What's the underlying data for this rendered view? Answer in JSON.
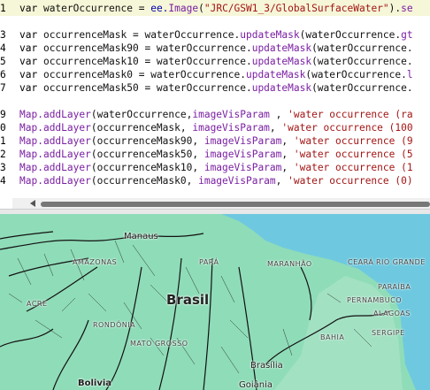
{
  "editor": {
    "lines": [
      {
        "num": "1",
        "parts": [
          [
            "kw",
            "var "
          ],
          [
            "code",
            "waterOccurrence = "
          ],
          [
            "obj",
            "ee."
          ],
          [
            "m",
            "Image"
          ],
          [
            "code",
            "("
          ],
          [
            "str",
            "\"JRC/GSW1_3/GlobalSurfaceWater\""
          ],
          [
            "code",
            ")."
          ],
          [
            "m",
            "se"
          ]
        ]
      },
      {
        "num": "",
        "parts": []
      },
      {
        "num": "3",
        "parts": [
          [
            "kw",
            "var "
          ],
          [
            "code",
            "occurrenceMask = waterOccurrence."
          ],
          [
            "m",
            "updateMask"
          ],
          [
            "code",
            "(waterOccurrence."
          ],
          [
            "m",
            "gt"
          ]
        ]
      },
      {
        "num": "4",
        "parts": [
          [
            "kw",
            "var "
          ],
          [
            "code",
            "occurrenceMask90 = waterOccurrence."
          ],
          [
            "m",
            "updateMask"
          ],
          [
            "code",
            "(waterOccurrence."
          ]
        ]
      },
      {
        "num": "5",
        "parts": [
          [
            "kw",
            "var "
          ],
          [
            "code",
            "occurrenceMask10 = waterOccurrence."
          ],
          [
            "m",
            "updateMask"
          ],
          [
            "code",
            "(waterOccurrence."
          ]
        ]
      },
      {
        "num": "6",
        "parts": [
          [
            "kw",
            "var "
          ],
          [
            "code",
            "occurrenceMask0 = waterOccurrence."
          ],
          [
            "m",
            "updateMask"
          ],
          [
            "code",
            "(waterOccurrence."
          ],
          [
            "m",
            "l"
          ]
        ]
      },
      {
        "num": "7",
        "parts": [
          [
            "kw",
            "var "
          ],
          [
            "code",
            "occurrenceMask50 = waterOccurrence."
          ],
          [
            "m",
            "updateMask"
          ],
          [
            "code",
            "(waterOccurrence."
          ]
        ]
      },
      {
        "num": "",
        "parts": []
      },
      {
        "num": "9",
        "parts": [
          [
            "m",
            "Map."
          ],
          [
            "m",
            "addLayer"
          ],
          [
            "code",
            "(waterOccurrence,"
          ],
          [
            "m",
            "imageVisParam"
          ],
          [
            "code",
            " , "
          ],
          [
            "str",
            "'water occurrence (ra"
          ]
        ]
      },
      {
        "num": "0",
        "parts": [
          [
            "m",
            "Map."
          ],
          [
            "m",
            "addLayer"
          ],
          [
            "code",
            "(occurrenceMask, "
          ],
          [
            "m",
            "imageVisParam"
          ],
          [
            "code",
            ", "
          ],
          [
            "str",
            "'water occurrence (100"
          ]
        ]
      },
      {
        "num": "1",
        "parts": [
          [
            "m",
            "Map."
          ],
          [
            "m",
            "addLayer"
          ],
          [
            "code",
            "(occurrenceMask90, "
          ],
          [
            "m",
            "imageVisParam"
          ],
          [
            "code",
            ", "
          ],
          [
            "str",
            "'water occurrence (9"
          ]
        ]
      },
      {
        "num": "2",
        "parts": [
          [
            "m",
            "Map."
          ],
          [
            "m",
            "addLayer"
          ],
          [
            "code",
            "(occurrenceMask50, "
          ],
          [
            "m",
            "imageVisParam"
          ],
          [
            "code",
            ", "
          ],
          [
            "str",
            "'water occurrence (5"
          ]
        ]
      },
      {
        "num": "3",
        "parts": [
          [
            "m",
            "Map."
          ],
          [
            "m",
            "addLayer"
          ],
          [
            "code",
            "(occurrenceMask10, "
          ],
          [
            "m",
            "imageVisParam"
          ],
          [
            "code",
            ", "
          ],
          [
            "str",
            "'water occurrence (1"
          ]
        ]
      },
      {
        "num": "4",
        "parts": [
          [
            "m",
            "Map."
          ],
          [
            "m",
            "addLayer"
          ],
          [
            "code",
            "(occurrenceMask0, "
          ],
          [
            "m",
            "imageVisParam"
          ],
          [
            "code",
            ", "
          ],
          [
            "str",
            "'water occurrence (0)"
          ]
        ]
      }
    ]
  },
  "map": {
    "labels": {
      "manaus": "Manaus",
      "amazonas": "AMAZONAS",
      "para": "PARÁ",
      "maranhao": "MARANHÃO",
      "ceara": "CEARÁ",
      "rio_grande": "RIO GRANDE",
      "paraiba": "PARAÍBA",
      "pernambuco": "PERNAMBUCO",
      "alagoas": "ALAGOAS",
      "sergipe": "SERGIPE",
      "bahia": "BAHIA",
      "acre": "ACRE",
      "rondonia": "RONDÔNIA",
      "mato_grosso": "MATO GROSSO",
      "brasil": "Brasil",
      "brasilia": "Brasília",
      "goiania": "Goiânia",
      "bolivia": "Bolivia"
    },
    "colors": {
      "land": "#8fdcb8",
      "ocean": "#6ec9e0",
      "rivers": "#111111"
    }
  }
}
